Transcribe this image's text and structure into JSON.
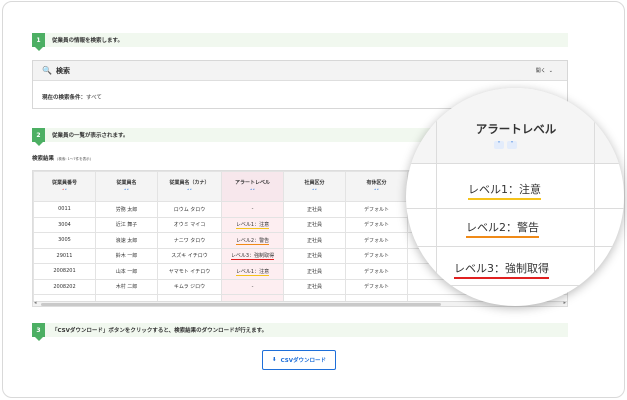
{
  "steps": [
    {
      "num": "1",
      "text": "従業員の情報を検索します。"
    },
    {
      "num": "2",
      "text": "従業員の一覧が表示されます。"
    },
    {
      "num": "3",
      "text": "「CSVダウンロード」ボタンをクリックすると、検索結果のダウンロードが行えます。"
    }
  ],
  "search": {
    "icon": "search-icon",
    "title": "検索",
    "toggle_label": "開く",
    "condition_label": "現在の検索条件：",
    "condition_value": "すべて"
  },
  "results": {
    "title": "検索結果",
    "count_note": "(検索: 1～7件を表示)",
    "columns": [
      "従業員番号",
      "従業員名",
      "従業員名（カナ）",
      "アラートレベル",
      "社員区分",
      "有休区分"
    ],
    "rows": [
      [
        "0011",
        "労務 太郎",
        "ロウム タロウ",
        "-",
        "正社員",
        "デフォルト"
      ],
      [
        "3004",
        "近江 舞子",
        "オウミ マイコ",
        "レベル1：注意",
        "正社員",
        "デフォルト"
      ],
      [
        "3005",
        "浪速 太郎",
        "ナニワ タロウ",
        "レベル2：警告",
        "正社員",
        "デフォルト"
      ],
      [
        "29011",
        "鈴木 一郎",
        "スズキ イチロウ",
        "レベル3：強制取得",
        "正社員",
        "デフォルト"
      ],
      [
        "2008201",
        "山本 一郎",
        "ヤマモト イチロウ",
        "レベル1：注意",
        "正社員",
        "デフォルト"
      ],
      [
        "2008202",
        "木村 二郎",
        "キムラ ジロウ",
        "-",
        "正社員",
        "デフォルト"
      ],
      [
        "",
        "",
        "",
        "",
        "",
        ""
      ]
    ]
  },
  "zoom": {
    "header": "アラートレベル",
    "cells": [
      "レベル1：注意",
      "レベル2：警告",
      "レベル3：強制取得"
    ]
  },
  "csv_button": {
    "icon": "download-icon",
    "label": "CSVダウンロード"
  },
  "colors": {
    "step_green": "#4caf63",
    "accent_blue": "#1e6fd9",
    "level1": "#f5c21b",
    "level2": "#f08a17",
    "level3": "#e02020",
    "alert_column_bg": "#fdeef1"
  }
}
